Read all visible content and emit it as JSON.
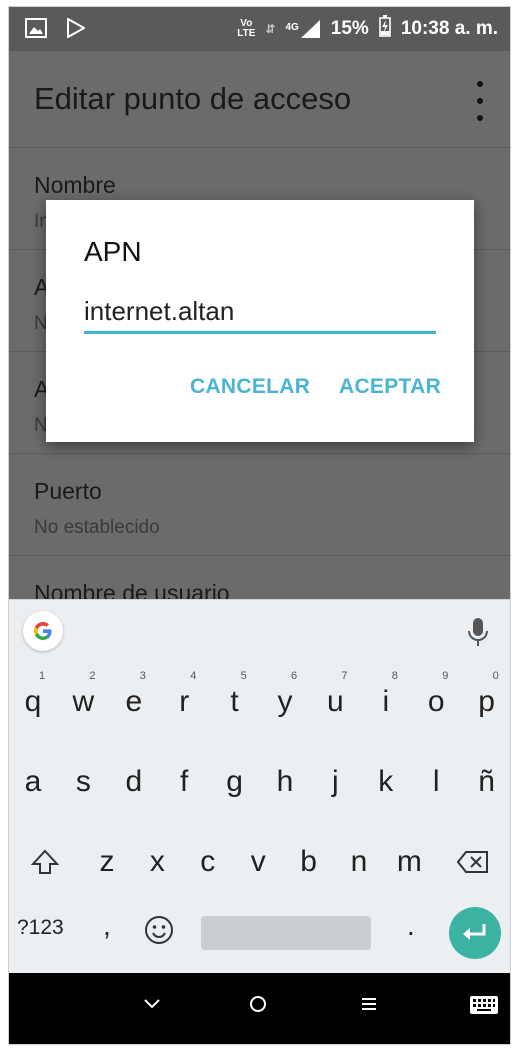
{
  "status_bar": {
    "volte_line1": "Vo",
    "volte_line2": "LTE",
    "network": "4G",
    "battery": "15%",
    "time": "10:38 a. m."
  },
  "app_bar": {
    "title": "Editar punto de acceso"
  },
  "settings_list": {
    "items": [
      {
        "title": "Nombre",
        "subtitle": "In"
      },
      {
        "title": "A",
        "subtitle": "N"
      },
      {
        "title": "A",
        "subtitle": "N"
      },
      {
        "title": "Puerto",
        "subtitle": "No establecido"
      },
      {
        "title": "Nombre de usuario",
        "subtitle": ""
      }
    ]
  },
  "dialog": {
    "title": "APN",
    "input_value": "internet.altan",
    "cancel_label": "CANCELAR",
    "accept_label": "ACEPTAR"
  },
  "keyboard": {
    "row1": [
      "q",
      "w",
      "e",
      "r",
      "t",
      "y",
      "u",
      "i",
      "o",
      "p"
    ],
    "row1_hints": [
      "1",
      "2",
      "3",
      "4",
      "5",
      "6",
      "7",
      "8",
      "9",
      "0"
    ],
    "row2": [
      "a",
      "s",
      "d",
      "f",
      "g",
      "h",
      "j",
      "k",
      "l",
      "ñ"
    ],
    "row3": [
      "z",
      "x",
      "c",
      "v",
      "b",
      "n",
      "m"
    ],
    "symbols_label": "?123",
    "comma": ",",
    "period": "."
  },
  "icons": [
    "image-icon",
    "play-store-icon",
    "signal-icon",
    "battery-charging-icon",
    "more-vert-icon",
    "google-g-icon",
    "mic-icon",
    "shift-icon",
    "backspace-icon",
    "emoji-icon",
    "enter-icon",
    "nav-back-icon",
    "nav-home-icon",
    "nav-recents-icon",
    "keyboard-switch-icon"
  ],
  "colors": {
    "accent": "#4bb4d4",
    "input_underline": "#3fb8c8",
    "enter_key": "#3cb2a3",
    "scrim": "#6b6b6b"
  }
}
